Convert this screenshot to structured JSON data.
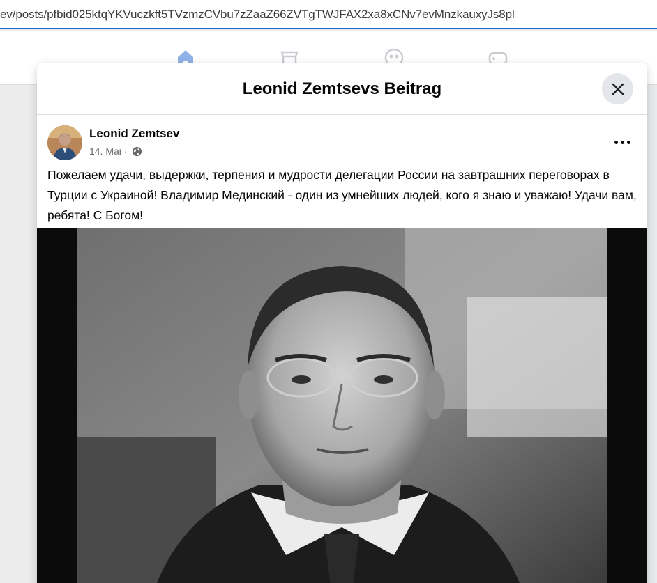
{
  "browser": {
    "url": "ev/posts/pfbid025ktqYKVuczkft5TVzmzCVbu7zZaaZ66ZVTgTWJFAX2xa8xCNv7evMnzkauxyJs8pl"
  },
  "nav": {
    "icons": [
      "home-icon",
      "marketplace-icon",
      "groups-icon",
      "gaming-icon"
    ],
    "accent_color": "#1877f2"
  },
  "modal": {
    "title": "Leonid Zemtsevs Beitrag",
    "close_icon": "close-icon"
  },
  "post": {
    "author": "Leonid Zemtsev",
    "date": "14. Mai",
    "separator": "·",
    "privacy_icon": "globe-icon",
    "more_icon": "more-options-icon",
    "text": "Пожелаем удачи, выдержки, терпения и мудрости делегации России на завтрашних переговорах в Турции с Украиной! Владимир Мединский - один из умнейших людей, кого я знаю и уважаю! Удачи вам, ребята! С Богом!"
  }
}
